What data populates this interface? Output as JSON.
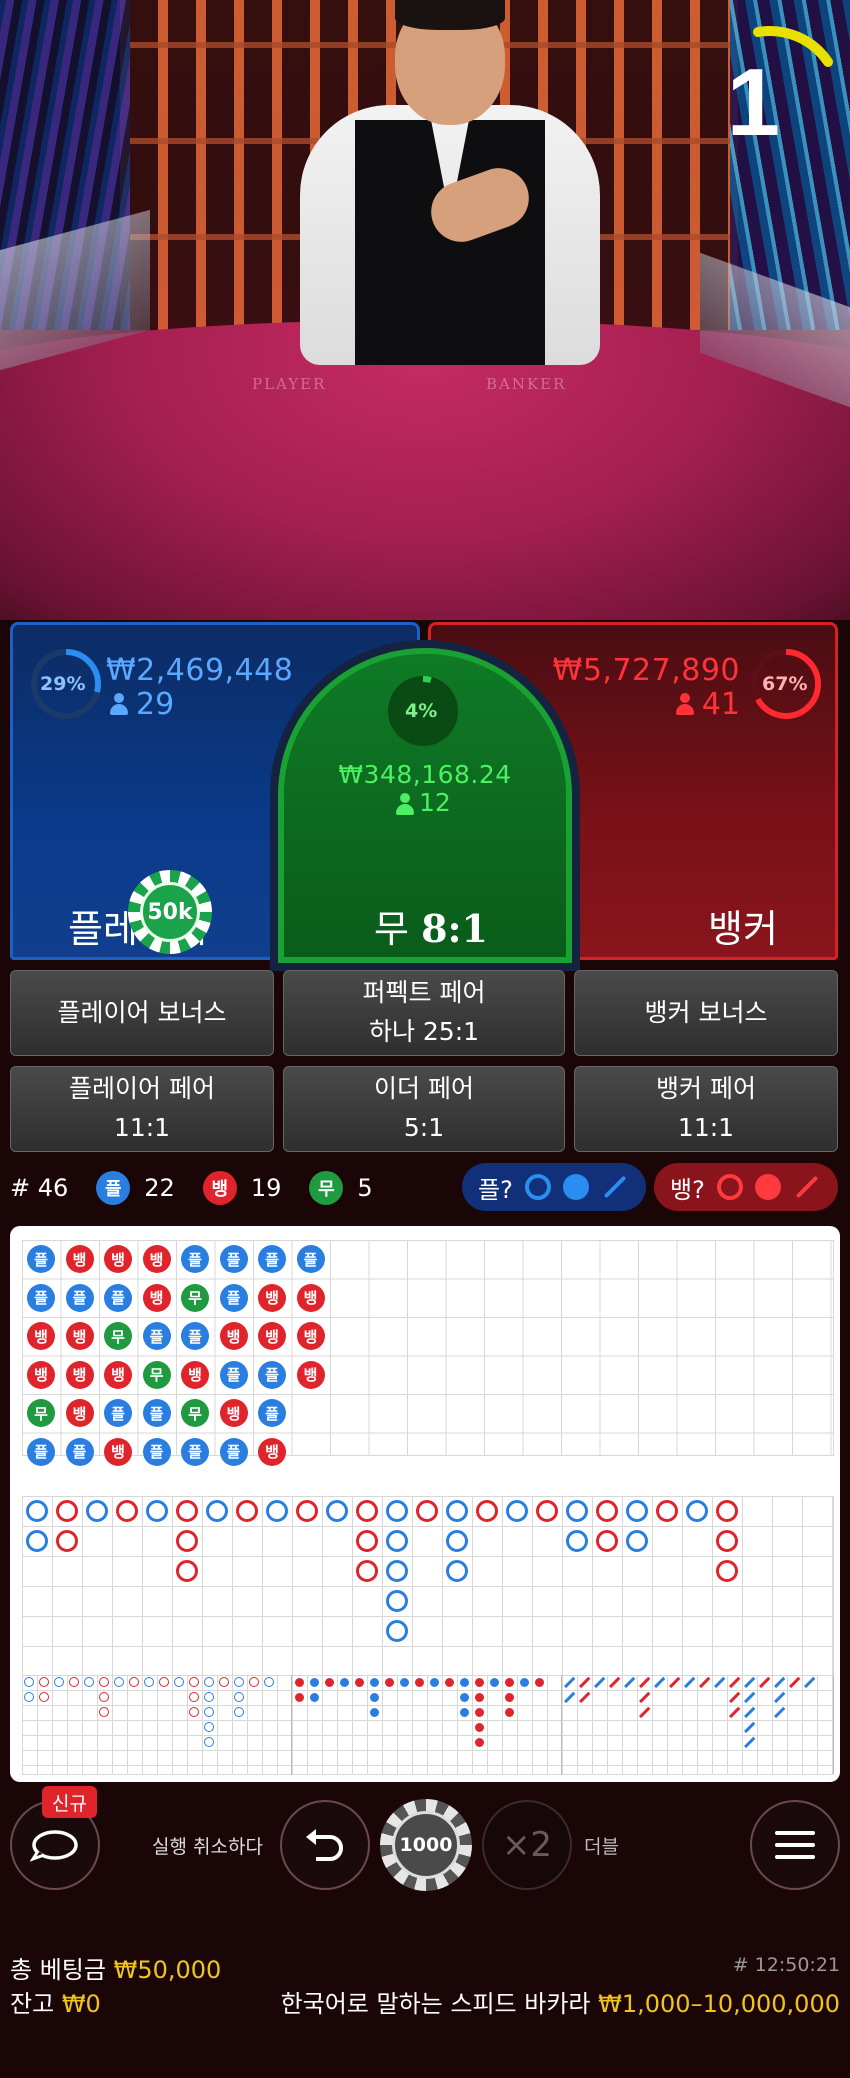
{
  "video": {
    "round_number": "1",
    "table_text_player": "PLAYER",
    "table_text_banker": "BANKER"
  },
  "bets": {
    "player": {
      "percent": "29%",
      "percent_value": 29,
      "amount": "₩2,469,448",
      "players": "29",
      "label": "플레이어",
      "chip": "50k"
    },
    "tie": {
      "percent": "4%",
      "percent_value": 4,
      "amount": "₩348,168.24",
      "players": "12",
      "label": "무",
      "payout": "8:1"
    },
    "banker": {
      "percent": "67%",
      "percent_value": 67,
      "amount": "₩5,727,890",
      "players": "41",
      "label": "뱅커"
    }
  },
  "side_bets": {
    "player_bonus": "플레이어 보너스",
    "perfect_pair": "퍼펙트 페어",
    "perfect_pair_odds": "하나 25:1",
    "banker_bonus": "뱅커 보너스",
    "player_pair": "플레이어 페어",
    "player_pair_odds": "11:1",
    "either_pair": "이더 페어",
    "either_pair_odds": "5:1",
    "banker_pair": "뱅커 페어",
    "banker_pair_odds": "11:1"
  },
  "stats": {
    "rounds": "# 46",
    "player_letter": "플",
    "player_count": "22",
    "banker_letter": "뱅",
    "banker_count": "19",
    "tie_letter": "무",
    "tie_count": "5",
    "player_predict": "플?",
    "banker_predict": "뱅?"
  },
  "road": {
    "bead": [
      [
        "플",
        "플",
        "뱅",
        "뱅",
        "무",
        "플"
      ],
      [
        "뱅",
        "플",
        "뱅",
        "뱅",
        "뱅",
        "플"
      ],
      [
        "뱅",
        "플",
        "무",
        "뱅",
        "플",
        "뱅"
      ],
      [
        "뱅",
        "뱅",
        "플",
        "무",
        "플",
        "플"
      ],
      [
        "플",
        "무",
        "플",
        "뱅",
        "무",
        "플"
      ],
      [
        "플",
        "플",
        "뱅",
        "플",
        "뱅",
        "플"
      ],
      [
        "플",
        "뱅",
        "뱅",
        "플",
        "플",
        "뱅"
      ],
      [
        "플",
        "뱅",
        "뱅",
        "뱅",
        "",
        ""
      ]
    ]
  },
  "controls": {
    "new_badge": "신규",
    "undo_label": "실행 취소하다",
    "chip_value": "1000",
    "double_symbol": "×2",
    "double_label": "더블"
  },
  "footer": {
    "total_bet_label": "총 베팅금",
    "total_bet_value": "₩50,000",
    "balance_label": "잔고",
    "balance_value": "₩0",
    "round_id": "# 12:50:21",
    "game_name": "한국어로 말하는 스피드 바카라",
    "limits": "₩1,000–10,000,000"
  },
  "colors": {
    "player": "#2a7ee0",
    "banker": "#e0242b",
    "tie": "#1f9a40",
    "gold": "#f0c419"
  }
}
